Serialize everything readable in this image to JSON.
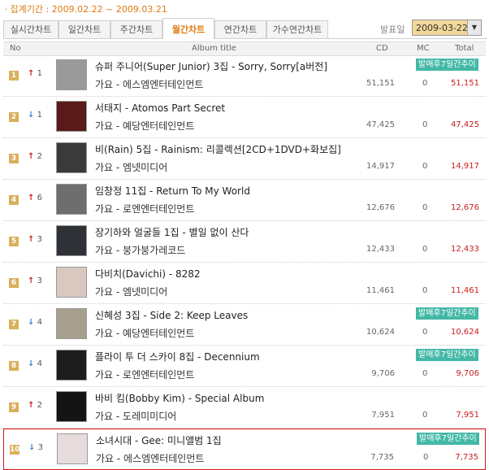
{
  "period_text": "집계기간 : 2009.02.22 ~ 2009.03.21",
  "tabs": [
    {
      "label": "실시간차트",
      "active": false
    },
    {
      "label": "일간차트",
      "active": false
    },
    {
      "label": "주간차트",
      "active": false
    },
    {
      "label": "월간차트",
      "active": true
    },
    {
      "label": "연간차트",
      "active": false
    },
    {
      "label": "가수연간차트",
      "active": false
    }
  ],
  "date_filter": {
    "label": "발표일",
    "value": "2009-03-22"
  },
  "columns": {
    "no": "No",
    "album": "Album title",
    "cd": "CD",
    "mc": "MC",
    "total": "Total"
  },
  "rows": [
    {
      "rank": "1",
      "dir": "up",
      "change": "1",
      "title": "슈퍼 주니어(Super Junior) 3집 - Sorry, Sorry[a버전]",
      "genre": "가요 - 에스엠엔터테인먼트",
      "cd": "51,151",
      "mc": "0",
      "total": "51,151",
      "badge": "발매후7일간추이",
      "thumb": "#9a9a9a"
    },
    {
      "rank": "2",
      "dir": "down",
      "change": "1",
      "title": "서태지 - Atomos Part Secret",
      "genre": "가요 - 예당엔터테인먼트",
      "cd": "47,425",
      "mc": "0",
      "total": "47,425",
      "badge": "",
      "thumb": "#5a1a1a"
    },
    {
      "rank": "3",
      "dir": "up",
      "change": "2",
      "title": "비(Rain) 5집 - Rainism: 리콜렉션[2CD+1DVD+화보집]",
      "genre": "가요 - 엠넷미디어",
      "cd": "14,917",
      "mc": "0",
      "total": "14,917",
      "badge": "",
      "thumb": "#3a3a3a"
    },
    {
      "rank": "4",
      "dir": "up",
      "change": "6",
      "title": "임창정 11집 - Return To My World",
      "genre": "가요 - 로엔엔터테인먼트",
      "cd": "12,676",
      "mc": "0",
      "total": "12,676",
      "badge": "",
      "thumb": "#6e6e6e"
    },
    {
      "rank": "5",
      "dir": "up",
      "change": "3",
      "title": "장기하와 얼굴들 1집 - 별일 없이 산다",
      "genre": "가요 - 붕가붕가레코드",
      "cd": "12,433",
      "mc": "0",
      "total": "12,433",
      "badge": "",
      "thumb": "#2e3236"
    },
    {
      "rank": "6",
      "dir": "up",
      "change": "3",
      "title": "다비치(Davichi) - 8282",
      "genre": "가요 - 엠넷미디어",
      "cd": "11,461",
      "mc": "0",
      "total": "11,461",
      "badge": "",
      "thumb": "#d8c8c0"
    },
    {
      "rank": "7",
      "dir": "down",
      "change": "4",
      "title": "신혜성 3집 - Side 2: Keep Leaves",
      "genre": "가요 - 예당엔터테인먼트",
      "cd": "10,624",
      "mc": "0",
      "total": "10,624",
      "badge": "발매후7일간추이",
      "thumb": "#a89e8e"
    },
    {
      "rank": "8",
      "dir": "down",
      "change": "4",
      "title": "플라이 투 더 스카이 8집 - Decennium",
      "genre": "가요 - 로엔엔터테인먼트",
      "cd": "9,706",
      "mc": "0",
      "total": "9,706",
      "badge": "발매후7일간추이",
      "thumb": "#1c1c1c"
    },
    {
      "rank": "9",
      "dir": "up",
      "change": "2",
      "title": "바비 킴(Bobby Kim) - Special Album",
      "genre": "가요 - 도레미미디어",
      "cd": "7,951",
      "mc": "0",
      "total": "7,951",
      "badge": "",
      "thumb": "#141414"
    },
    {
      "rank": "10",
      "dir": "down",
      "change": "3",
      "title": "소녀시대 - Gee: 미니앨범 1집",
      "genre": "가요 - 에스엠엔터테인먼트",
      "cd": "7,735",
      "mc": "0",
      "total": "7,735",
      "badge": "발매후7일간추이",
      "thumb": "#e6dcdc",
      "highlight": true
    }
  ],
  "colors": {
    "accent": "#e07a10",
    "total": "#c81e1e",
    "badge": "#43b8a6",
    "rank_box": "#d9b05a",
    "up": "#cc2222",
    "down": "#3a86c8"
  }
}
